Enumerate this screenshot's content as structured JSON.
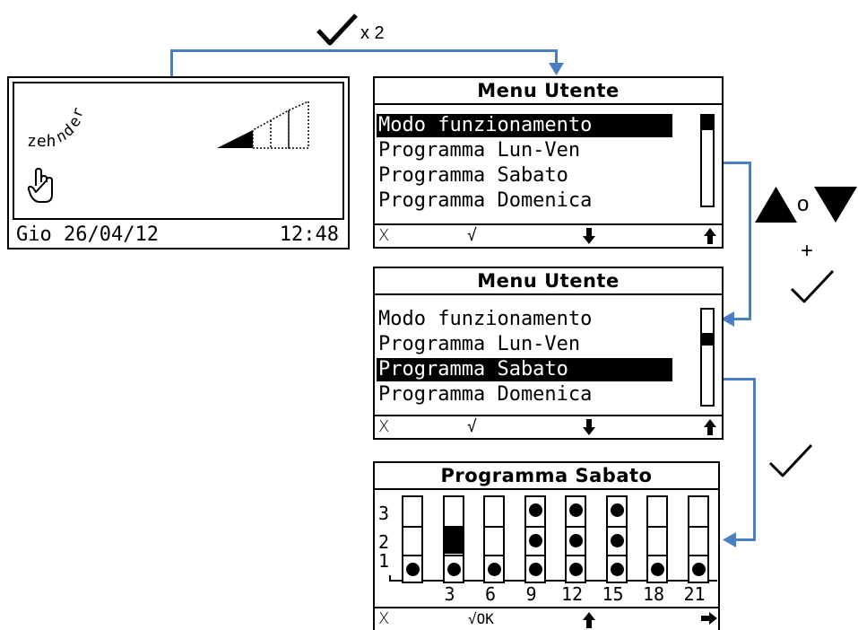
{
  "flow": {
    "top_check_count": "x 2",
    "up_or_down_sep": "o",
    "plus": "+"
  },
  "home_screen": {
    "logo_text": "zehnder",
    "date": "Gio 26/04/12",
    "time": "12:48",
    "fan_level": 1,
    "fan_levels_total": 3
  },
  "menu_screen_1": {
    "title": "Menu Utente",
    "items": [
      "Modo funzionamento",
      "Programma Lun-Ven",
      "Programma Sabato",
      "Programma Domenica"
    ],
    "selected_index": 0,
    "softkeys": {
      "cancel": "X",
      "ok": "√"
    }
  },
  "menu_screen_2": {
    "title": "Menu Utente",
    "items": [
      "Modo funzionamento",
      "Programma Lun-Ven",
      "Programma Sabato",
      "Programma Domenica"
    ],
    "selected_index": 2,
    "softkeys": {
      "cancel": "X",
      "ok": "√"
    }
  },
  "program_screen": {
    "title": "Programma Sabato",
    "level_labels": [
      "3",
      "2",
      "1"
    ],
    "hour_labels": [
      "3",
      "6",
      "9",
      "12",
      "15",
      "18",
      "21"
    ],
    "columns": [
      1,
      2,
      1,
      3,
      3,
      3,
      1,
      1
    ],
    "softkeys": {
      "cancel": "X",
      "ok": "√OK"
    }
  }
}
